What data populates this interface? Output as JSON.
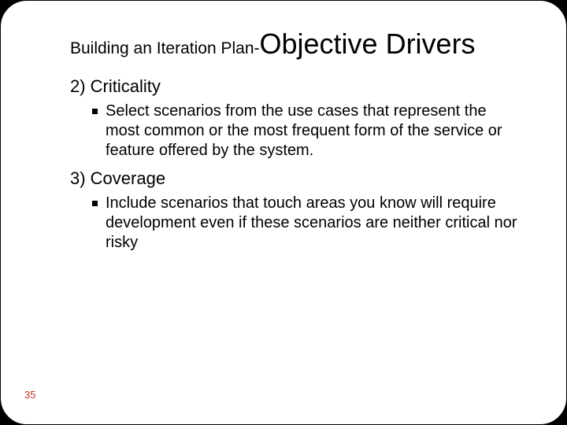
{
  "title": {
    "prefix": "Building an Iteration Plan-",
    "main": "Objective Drivers"
  },
  "sections": [
    {
      "heading": "2) Criticality",
      "bullet": "Select scenarios from the use cases that represent the most common or the most frequent form of the service or feature offered by the system."
    },
    {
      "heading": "3) Coverage",
      "bullet": "Include scenarios that touch areas you know will require development even if these scenarios are neither critical nor risky"
    }
  ],
  "page_number": "35"
}
